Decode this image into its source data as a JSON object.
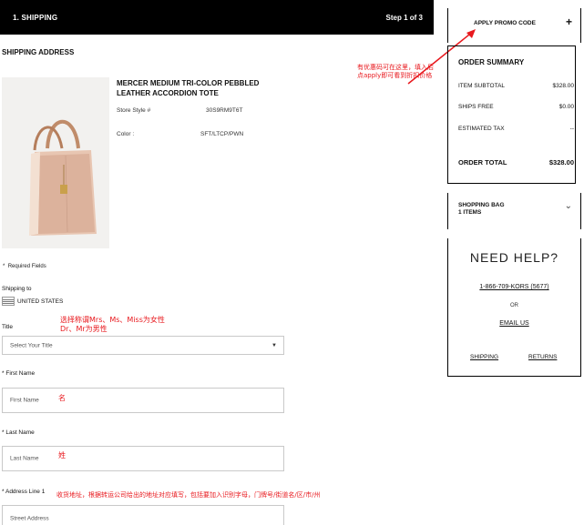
{
  "step": {
    "title": "1. SHIPPING",
    "count": "Step 1 of 3"
  },
  "section_title": "SHIPPING ADDRESS",
  "product": {
    "title": "MERCER MEDIUM TRI-COLOR PEBBLED LEATHER ACCORDION TOTE",
    "style_label": "Store Style #",
    "style_value": "30S9RM9T6T",
    "color_label": "Color :",
    "color_value": "SFT/LTCP/PWN"
  },
  "required_note": "Required Fields",
  "shipping_to": {
    "label": "Shipping to",
    "country": "UNITED STATES"
  },
  "form": {
    "title_label": "Title",
    "title_placeholder": "Select Your Title",
    "first_name_label": "First Name",
    "first_name_placeholder": "First Name",
    "last_name_label": "Last Name",
    "last_name_placeholder": "Last Name",
    "address1_label": "Address Line 1",
    "address1_placeholder": "Street Address"
  },
  "annotations": {
    "promo": [
      "有优惠码可在这里，填入后",
      "点apply即可看到折扣价格"
    ],
    "title": [
      "选择称谓Mrs、Ms、Miss为女性",
      "Dr、Mr为男性"
    ],
    "first_name": "名",
    "last_name": "姓",
    "address": "收货地址，根据转运公司给出的地址对应填写，包括要加入识别字母，门牌号/街道名/区/市/州"
  },
  "promo": {
    "label": "APPLY PROMO CODE",
    "icon": "plus-icon"
  },
  "summary": {
    "heading": "ORDER SUMMARY",
    "rows": [
      {
        "label": "ITEM SUBTOTAL",
        "value": "$328.00"
      },
      {
        "label": "SHIPS FREE",
        "value": "$0.00"
      },
      {
        "label": "ESTIMATED TAX",
        "value": "--"
      }
    ],
    "total_label": "ORDER TOTAL",
    "total_value": "$328.00"
  },
  "bag": {
    "label": "SHOPPING BAG\n1 ITEMS",
    "line1": "SHOPPING BAG",
    "line2": "1 ITEMS"
  },
  "help": {
    "heading": "NEED HELP?",
    "phone": "1-866-709-KORS (5677)",
    "or": "OR",
    "email": "EMAIL US",
    "shipping_link": "SHIPPING",
    "returns_link": "RETURNS"
  },
  "colors": {
    "annotation": "#e8191e",
    "header_bg": "#000000"
  }
}
